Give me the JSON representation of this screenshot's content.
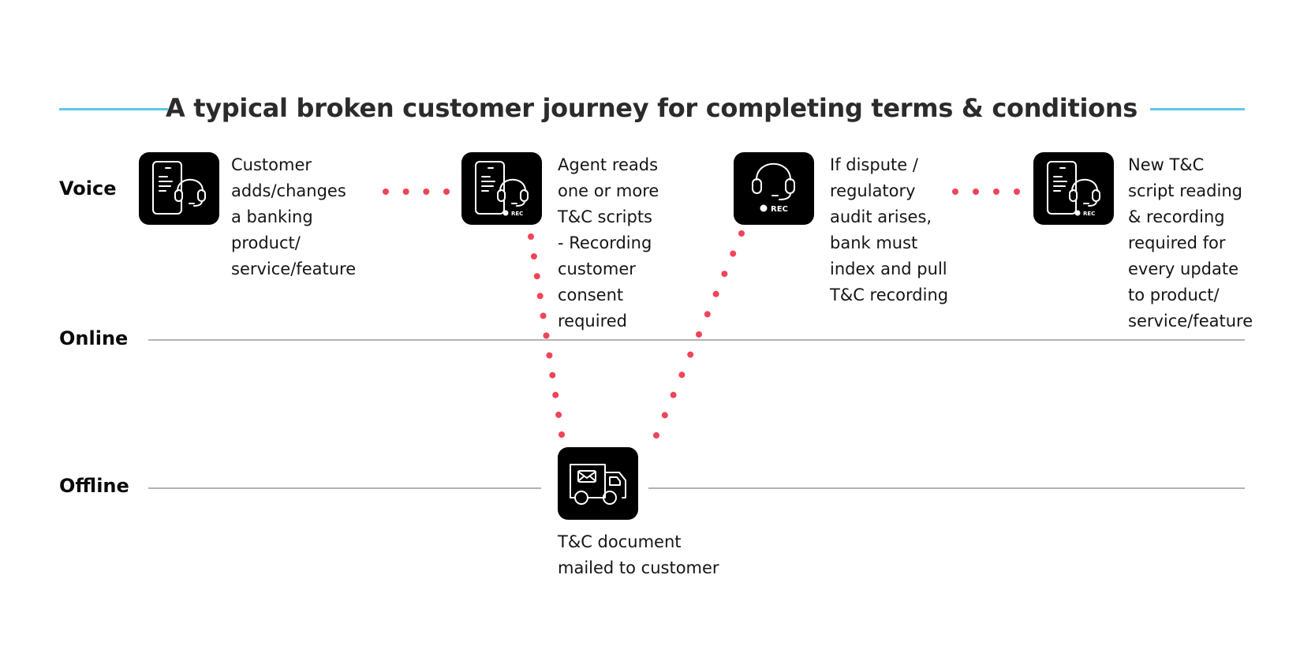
{
  "title": "A typical broken customer journey for completing terms & conditions",
  "colors": {
    "accent_line": "#5bc8e8",
    "dot": "#f04458",
    "lane_line": "#b3b3b3",
    "icon_bg": "#000000",
    "icon_stroke": "#ffffff"
  },
  "lanes": [
    {
      "label": "Voice"
    },
    {
      "label": "Online"
    },
    {
      "label": "Offline"
    }
  ],
  "steps": [
    {
      "icon": "phone-headset-icon",
      "lane": "Voice",
      "lines": [
        "Customer",
        "adds/changes",
        "a banking",
        "product/",
        "service/feature"
      ]
    },
    {
      "icon": "phone-headset-rec-icon",
      "lane": "Voice",
      "rec_label": "REC",
      "lines": [
        "Agent reads",
        "one or more",
        "T&C scripts",
        "- Recording",
        "customer",
        "consent",
        "required"
      ]
    },
    {
      "icon": "headset-rec-icon",
      "lane": "Voice",
      "rec_label": "REC",
      "lines": [
        "If dispute /",
        "regulatory",
        "audit arises,",
        "bank must",
        "index and pull",
        "T&C recording"
      ]
    },
    {
      "icon": "phone-headset-rec-icon",
      "lane": "Voice",
      "rec_label": "REC",
      "lines": [
        "New T&C",
        "script reading",
        "& recording",
        "required for",
        "every update",
        "to product/",
        "service/feature"
      ]
    },
    {
      "icon": "mail-truck-icon",
      "lane": "Offline",
      "lines": [
        "T&C document",
        "mailed to customer"
      ]
    }
  ],
  "connectors": [
    {
      "from": 0,
      "to": 1,
      "style": "dotted"
    },
    {
      "from": 1,
      "to": 4,
      "style": "dotted"
    },
    {
      "from": 4,
      "to": 2,
      "style": "dotted"
    },
    {
      "from": 2,
      "to": 3,
      "style": "dotted"
    }
  ]
}
